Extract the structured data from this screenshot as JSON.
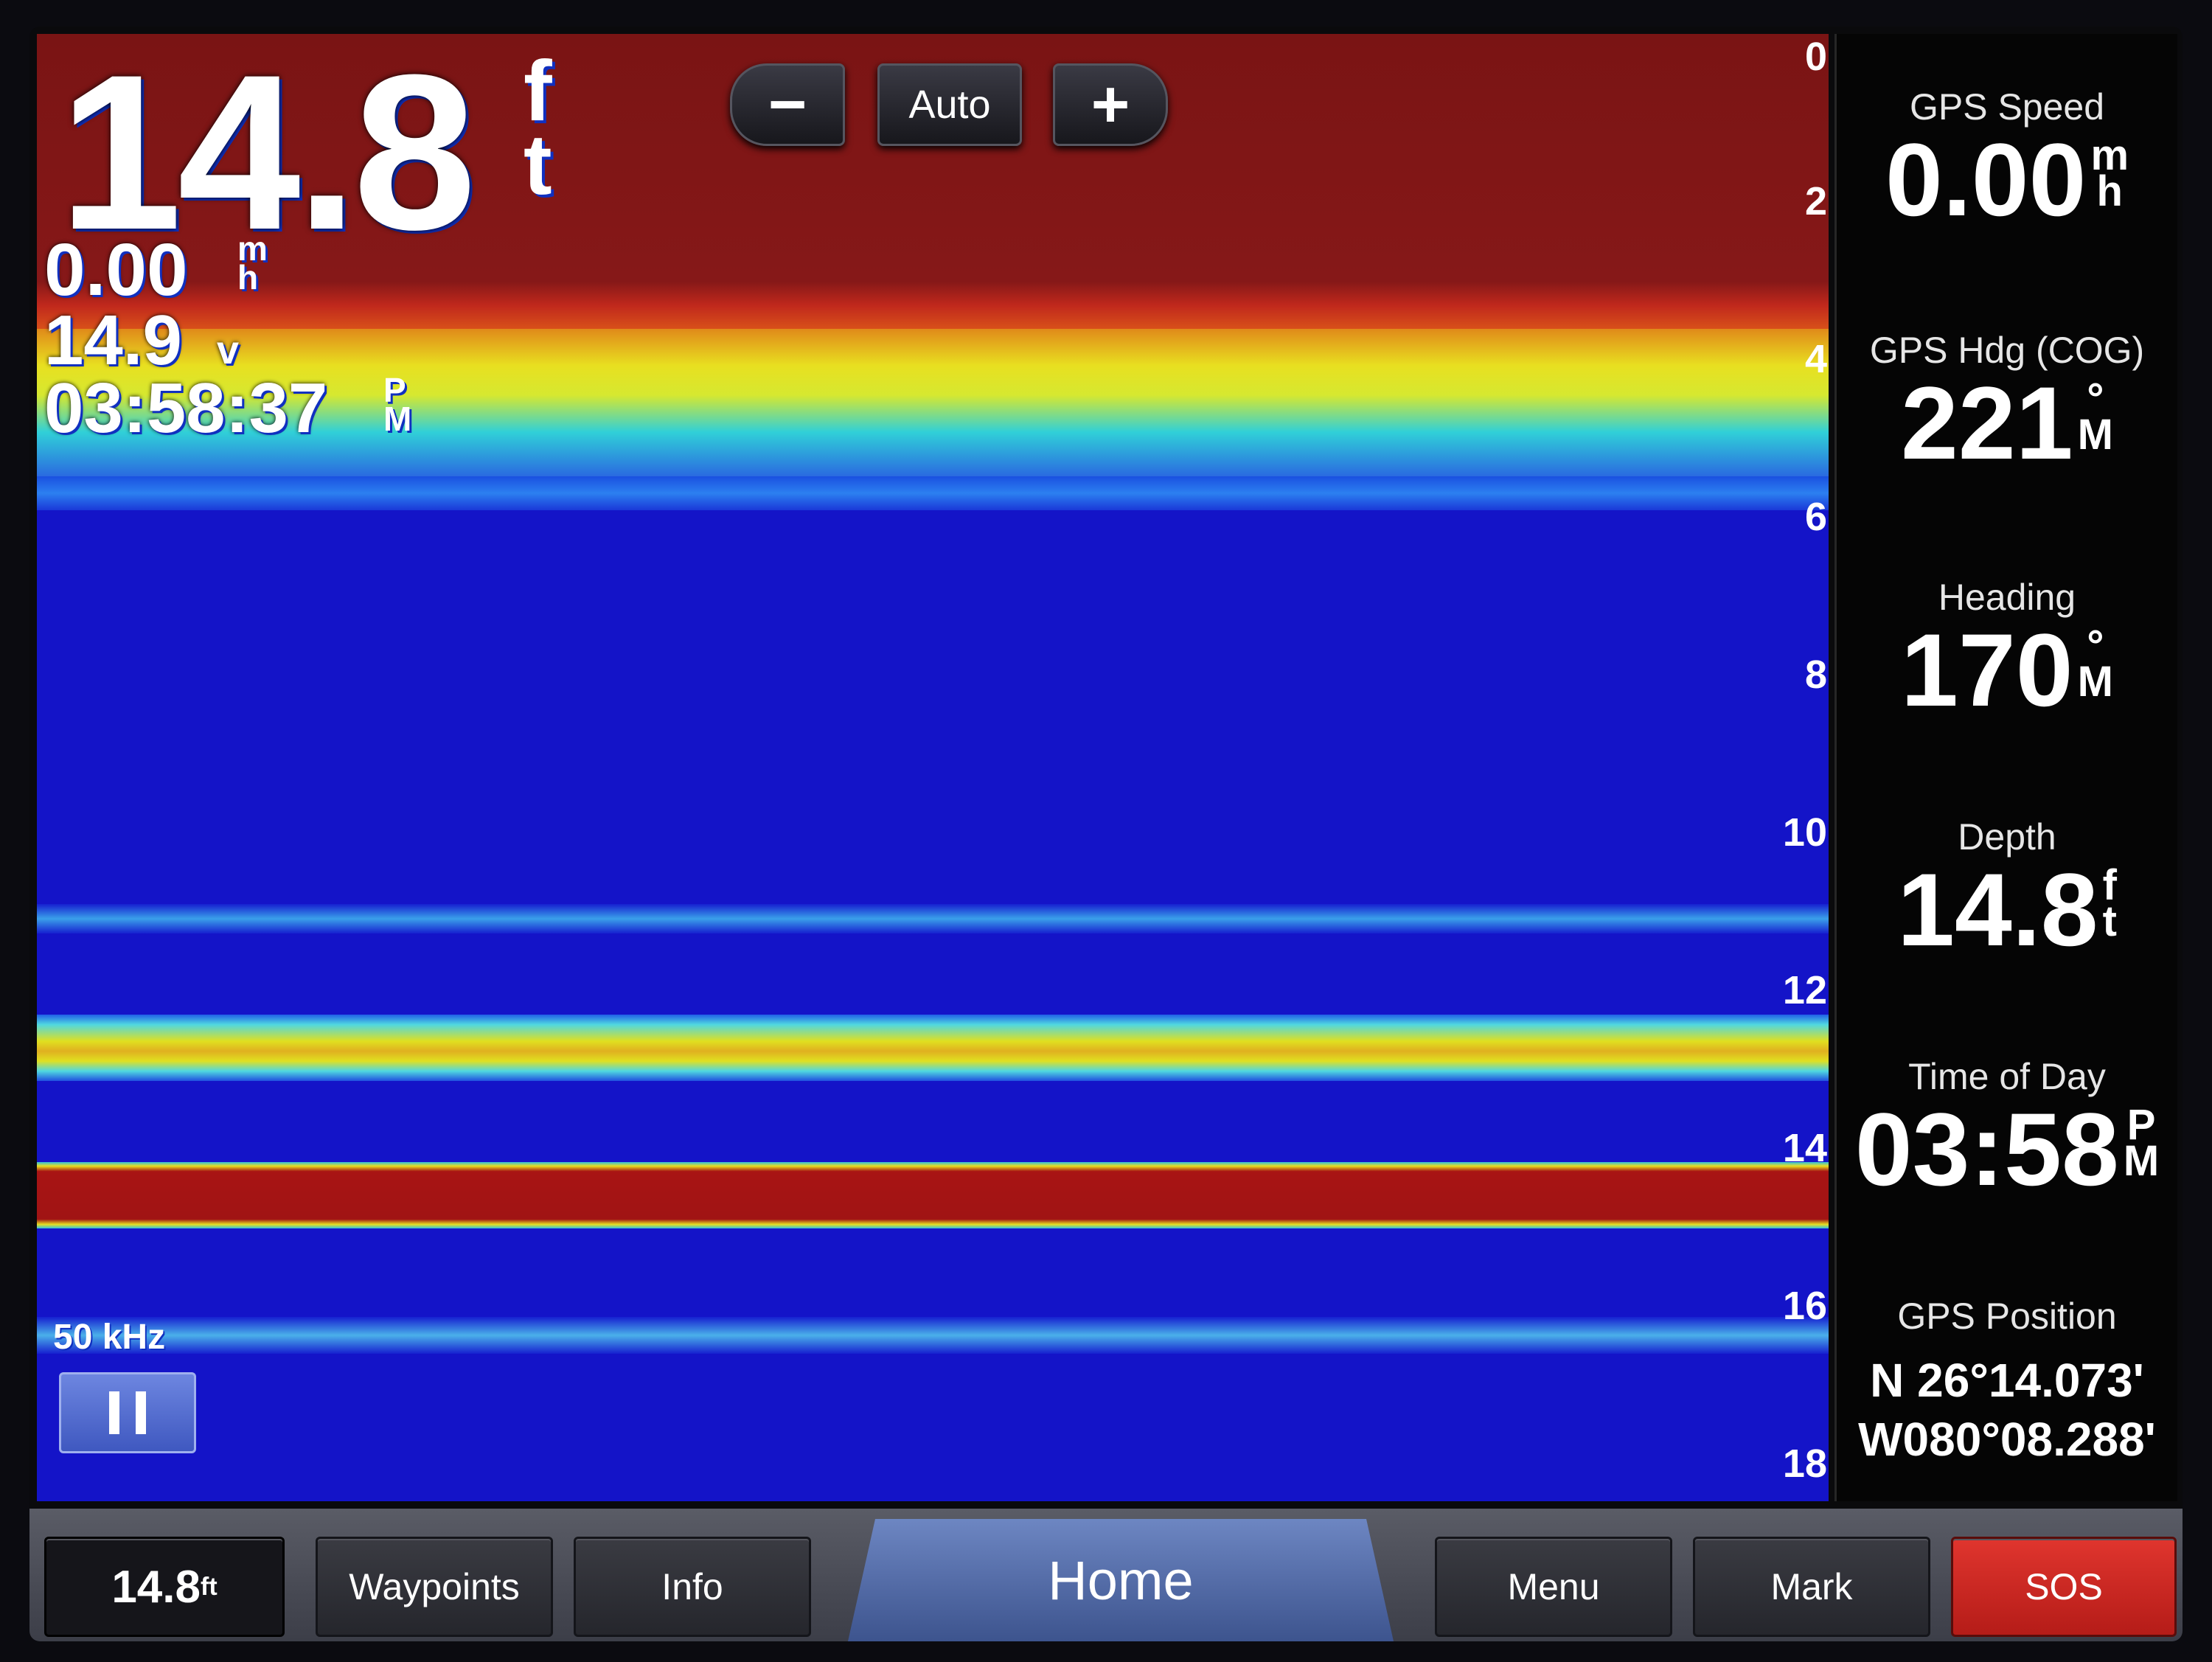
{
  "overlay": {
    "depth_value": "14.8",
    "depth_unit_top": "f",
    "depth_unit_bottom": "t",
    "speed_value": "0.00",
    "speed_unit_top": "m",
    "speed_unit_bottom": "h",
    "voltage_value": "14.9",
    "voltage_unit": "v",
    "time_value": "03:58:37",
    "time_unit_top": "P",
    "time_unit_bottom": "M",
    "frequency": "50 kHz"
  },
  "zoom": {
    "minus_label": "−",
    "auto_label": "Auto",
    "plus_label": "+"
  },
  "depth_scale": [
    "0",
    "2",
    "4",
    "6",
    "8",
    "10",
    "12",
    "14",
    "16",
    "18"
  ],
  "panel": {
    "gps_speed": {
      "label": "GPS Speed",
      "value": "0.00",
      "unit_top": "m",
      "unit_bottom": "h"
    },
    "gps_hdg": {
      "label": "GPS Hdg (COG)",
      "value": "221",
      "unit_top": "°",
      "unit_bottom": "M"
    },
    "heading": {
      "label": "Heading",
      "value": "170",
      "unit_top": "°",
      "unit_bottom": "M"
    },
    "depth": {
      "label": "Depth",
      "value": "14.8",
      "unit_top": "f",
      "unit_bottom": "t"
    },
    "time_of_day": {
      "label": "Time of Day",
      "value": "03:58",
      "unit_top": "P",
      "unit_bottom": "M"
    },
    "gps_position": {
      "label": "GPS Position",
      "lat": "N  26°14.073'",
      "lon": "W080°08.288'"
    }
  },
  "bottom_bar": {
    "depth_value": "14.8",
    "depth_unit": "ft",
    "waypoints": "Waypoints",
    "info": "Info",
    "home": "Home",
    "menu": "Menu",
    "mark": "Mark",
    "sos": "SOS"
  },
  "colors": {
    "water": "#1414c8",
    "strong_return": "#a01414",
    "surface": "#7a1414",
    "sos": "#d42a24"
  }
}
